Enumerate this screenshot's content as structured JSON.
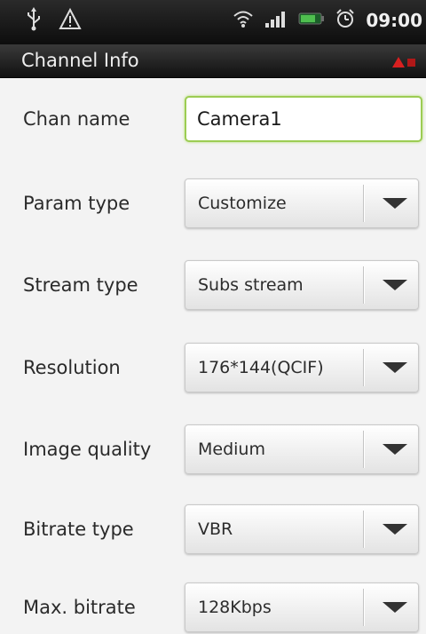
{
  "status_bar": {
    "time": "09:00",
    "icons": [
      "usb-icon",
      "warning-icon",
      "wifi-icon",
      "signal-icon",
      "battery-icon",
      "alarm-icon"
    ]
  },
  "header": {
    "title": "Channel Info"
  },
  "form": {
    "chan_name": {
      "label": "Chan name",
      "value": "Camera1"
    },
    "param_type": {
      "label": "Param type",
      "value": "Customize"
    },
    "stream_type": {
      "label": "Stream type",
      "value": "Subs stream"
    },
    "resolution": {
      "label": "Resolution",
      "value": "176*144(QCIF)"
    },
    "image_quality": {
      "label": "Image quality",
      "value": "Medium"
    },
    "bitrate_type": {
      "label": "Bitrate type",
      "value": "VBR"
    },
    "max_bitrate": {
      "label": "Max. bitrate",
      "value": "128Kbps"
    }
  },
  "colors": {
    "field_focus_border": "#9ccc53",
    "status_bar_bg": "#111111",
    "form_bg": "#f3f3f3"
  }
}
